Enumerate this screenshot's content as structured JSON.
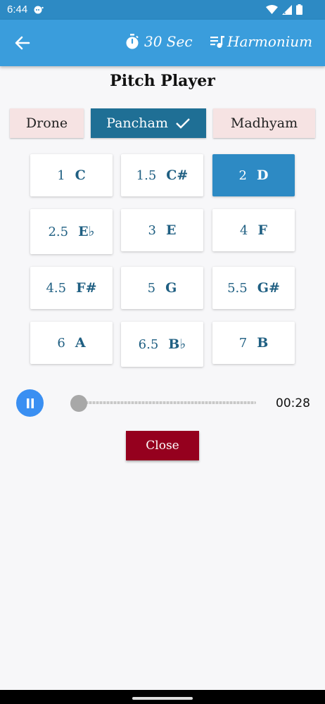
{
  "status_bar": {
    "time": "6:44"
  },
  "app_bar": {
    "timer_label": "30 Sec",
    "instrument_label": "Harmonium",
    "icons": [
      "back-arrow-icon",
      "stopwatch-icon",
      "playlist-music-icon"
    ]
  },
  "title": "Pitch Player",
  "modes": [
    {
      "label": "Drone",
      "active": false
    },
    {
      "label": "Pancham",
      "active": true
    },
    {
      "label": "Madhyam",
      "active": false
    }
  ],
  "pitches": [
    {
      "num": "1",
      "note": "C"
    },
    {
      "num": "1.5",
      "note": "C#"
    },
    {
      "num": "2",
      "note": "D",
      "selected": true
    },
    {
      "num": "2.5",
      "note": "E♭"
    },
    {
      "num": "3",
      "note": "E"
    },
    {
      "num": "4",
      "note": "F"
    },
    {
      "num": "4.5",
      "note": "F#"
    },
    {
      "num": "5",
      "note": "G"
    },
    {
      "num": "5.5",
      "note": "G#"
    },
    {
      "num": "6",
      "note": "A"
    },
    {
      "num": "6.5",
      "note": "B♭"
    },
    {
      "num": "7",
      "note": "B"
    }
  ],
  "player": {
    "time": "00:28",
    "progress": 0.0,
    "state": "playing"
  },
  "close_label": "Close",
  "colors": {
    "app_bar": "#3a9ddc",
    "status_bar": "#2d8ac4",
    "active_mode": "#1f6f95",
    "selected_pitch": "#2d8ac4",
    "close": "#95001e",
    "play": "#3a8ff2"
  }
}
